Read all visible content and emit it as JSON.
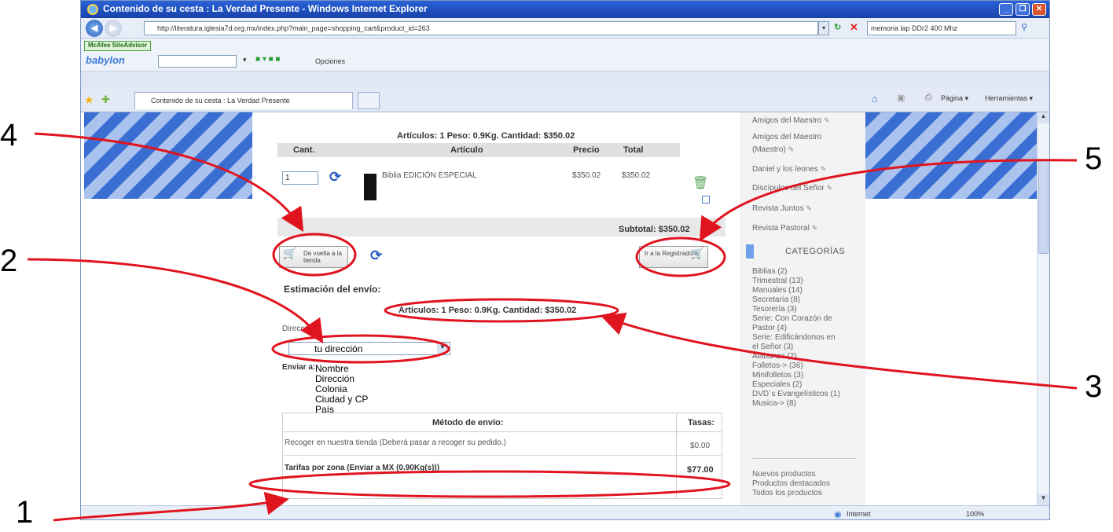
{
  "window": {
    "title": "Contenido de su cesta : La Verdad Presente - Windows Internet Explorer",
    "buttons": {
      "minimize": "_",
      "maximize": "❐",
      "close": "✕"
    }
  },
  "address_bar": {
    "url": "http://literatura.iglesia7d.org.mx/index.php?main_page=shopping_cart&product_id=263",
    "search_value": "memoria lap DDr2 400 Mhz"
  },
  "toolbar": {
    "mcafee_label": "McAfee SiteAdvisor",
    "babylon_label": "babylon",
    "options_label": "Opciones"
  },
  "tabs": {
    "active_label": "Contenido de su cesta : La Verdad Presente",
    "page_menu": "Página ▾",
    "tools_menu": "Herramientas ▾"
  },
  "cart": {
    "summary_top": "Artículos: 1  Peso: 0.9Kg.  Cantidad: $350.02",
    "headers": {
      "qty": "Cant.",
      "item": "Artículo",
      "price": "Precio",
      "total": "Total"
    },
    "row": {
      "qty": "1",
      "name": "Biblia EDICIÓN ESPECIAL",
      "price": "$350.02",
      "total": "$350.02"
    },
    "subtotal": "Subtotal: $350.02",
    "back_button": "De vuelta a la tienda",
    "checkout_button": "Ir a la Registradora"
  },
  "shipping": {
    "title": "Estimación del envío:",
    "summary": "Artículos: 1  Peso: 0.9Kg.  Cantidad: $350.02",
    "address_label": "Dirección:",
    "address_value": "tu dirección",
    "send_to_label": "Enviar a:",
    "send_to_lines": [
      "Nombre",
      "Dirección",
      "Colonia",
      "Ciudad y CP",
      "País"
    ],
    "table_headers": {
      "method": "Método de envío:",
      "rates": "Tasas:"
    },
    "rows": [
      {
        "name": "Recoger en nuestra tienda (Deberá pasar a recoger su pedido.)",
        "price": "$0.00"
      },
      {
        "name": "Tarifas por zona (Enviar a MX (0.90Kg(s)))",
        "price": "$77.00"
      }
    ]
  },
  "sidebar": {
    "top_items": [
      "Amigos del Maestro",
      "Amigos del Maestro",
      "(Maestro)",
      "Daniel y los leones",
      "Discípulos del Señor",
      "Revista Juntos",
      "Revista Pastoral"
    ],
    "categories_header": "CATEGORÍAS",
    "categories": [
      "Biblias (2)",
      "Trimestral (13)",
      "Manuales (14)",
      "Secretaría (8)",
      "Tesorería (3)",
      "Serie: Con Corazón de",
      "Pastor (4)",
      "Serie: Edificándonos en",
      "el Señor (3)",
      "Alabanza (2)",
      "Folletos-> (36)",
      "Minifolletos (3)",
      "Especiales (2)",
      "DVD´s Evangelísticos (1)",
      "Musica-> (8)"
    ],
    "bottom_links": [
      "Nuevos productos",
      "Productos destacados",
      "Todos los productos"
    ]
  },
  "status_bar": {
    "zone": "Internet",
    "zoom": "100%"
  },
  "annotations": [
    "1",
    "2",
    "3",
    "4",
    "5"
  ],
  "colors": {
    "annotation": "#e0141e",
    "stripe": "#3a6ed3",
    "title_bar": "#2a62d8"
  }
}
